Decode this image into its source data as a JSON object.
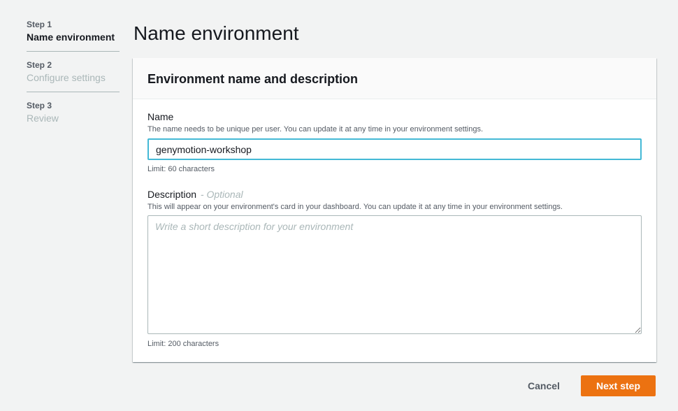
{
  "wizard": {
    "steps": [
      {
        "number": "Step 1",
        "label": "Name environment",
        "active": true
      },
      {
        "number": "Step 2",
        "label": "Configure settings",
        "active": false
      },
      {
        "number": "Step 3",
        "label": "Review",
        "active": false
      }
    ]
  },
  "page": {
    "title": "Name environment"
  },
  "card": {
    "title": "Environment name and description",
    "name": {
      "label": "Name",
      "hint": "The name needs to be unique per user. You can update it at any time in your environment settings.",
      "value": "genymotion-workshop",
      "limit": "Limit: 60 characters"
    },
    "description": {
      "label": "Description",
      "optional": "- Optional",
      "hint": "This will appear on your environment's card in your dashboard. You can update it at any time in your environment settings.",
      "value": "",
      "placeholder": "Write a short description for your environment",
      "limit": "Limit: 200 characters"
    }
  },
  "footer": {
    "cancel_label": "Cancel",
    "next_label": "Next step"
  },
  "colors": {
    "primary_button": "#ec7211",
    "focus_border": "#44b9d6",
    "background": "#f2f3f3"
  }
}
